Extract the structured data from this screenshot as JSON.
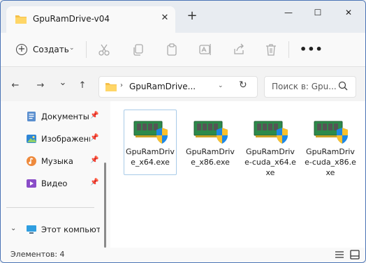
{
  "window": {
    "tab_title": "GpuRamDrive-v04",
    "tab_close": "✕",
    "new_tab": "+",
    "minimize": "—",
    "maximize": "☐",
    "close": "✕"
  },
  "toolbar": {
    "create_label": "Создать",
    "create_icon": "plus-circle-icon",
    "icons": [
      "cut-icon",
      "copy-icon",
      "paste-icon",
      "rename-icon",
      "share-icon",
      "delete-icon"
    ],
    "more": "•••"
  },
  "navigation": {
    "back": "←",
    "forward": "→",
    "recent": "⌄",
    "up": "↑",
    "path_sep": "›",
    "path": "GpuRamDrive...",
    "refresh": "↻",
    "search_placeholder": "Поиск в: Gpu..."
  },
  "sidebar": {
    "items": [
      {
        "label": "Документы",
        "icon": "documents-icon"
      },
      {
        "label": "Изображения",
        "icon": "pictures-icon"
      },
      {
        "label": "Музыка",
        "icon": "music-icon"
      },
      {
        "label": "Видео",
        "icon": "video-icon"
      }
    ],
    "pin": "📌",
    "this_pc": "Этот компьютер"
  },
  "files": [
    {
      "name": "GpuRamDrive_x64.exe",
      "selected": true
    },
    {
      "name": "GpuRamDrive_x86.exe",
      "selected": false
    },
    {
      "name": "GpuRamDrive-cuda_x64.exe",
      "selected": false
    },
    {
      "name": "GpuRamDrive-cuda_x86.exe",
      "selected": false
    }
  ],
  "status": {
    "count": "Элементов: 4"
  },
  "colors": {
    "accent": "#0067c0",
    "titlebar": "#e8ecf1",
    "selection_border": "#a8cbe8"
  }
}
